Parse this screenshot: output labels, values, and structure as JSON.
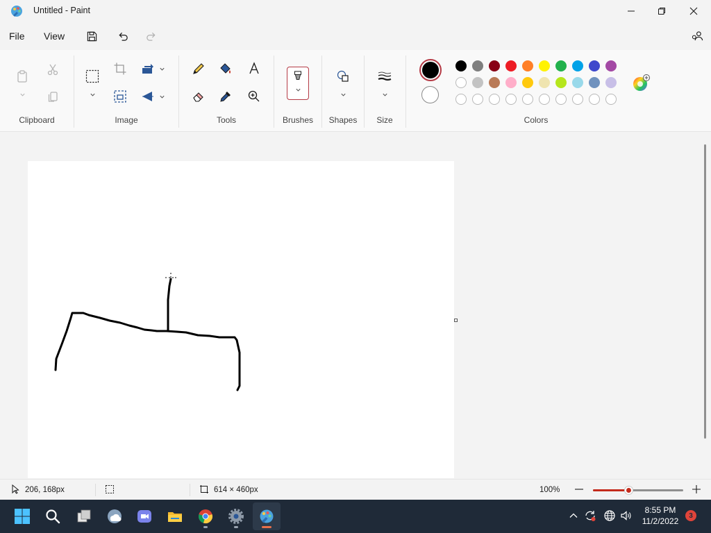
{
  "window": {
    "title": "Untitled - Paint",
    "controls": [
      "minimize-icon",
      "restore-icon",
      "close-icon"
    ]
  },
  "menu": {
    "file_label": "File",
    "view_label": "View",
    "quick_actions": [
      "save-icon",
      "undo-icon",
      "redo-icon"
    ]
  },
  "ribbon": {
    "clipboard": {
      "label": "Clipboard",
      "tools": [
        "paste-icon",
        "cut-icon",
        "copy-icon"
      ]
    },
    "image": {
      "label": "Image",
      "tools": [
        "select-icon",
        "crop-icon",
        "rotate-icon",
        "resize-icon",
        "flip-icon"
      ]
    },
    "tools": {
      "label": "Tools",
      "tools": [
        "pencil-icon",
        "fill-icon",
        "text-icon",
        "eraser-icon",
        "color-picker-icon",
        "magnifier-icon"
      ]
    },
    "brushes": {
      "label": "Brushes"
    },
    "shapes": {
      "label": "Shapes"
    },
    "size": {
      "label": "Size"
    },
    "colors": {
      "label": "Colors",
      "color1": "#000000",
      "color2": "#ffffff",
      "palette": [
        [
          "#000000",
          "#7f7f7f",
          "#880015",
          "#ed1c24",
          "#ff7f27",
          "#fff200",
          "#22b14c",
          "#00a2e8",
          "#3f48cc",
          "#a349a4"
        ],
        [
          "#ffffff",
          "#c3c3c3",
          "#b97a57",
          "#ffaec9",
          "#ffc90e",
          "#efe4b0",
          "#b5e61d",
          "#99d9ea",
          "#7092be",
          "#c8bfe7"
        ],
        [
          "",
          "",
          "",
          "",
          "",
          "",
          "",
          "",
          "",
          ""
        ]
      ]
    }
  },
  "status": {
    "cursor_position": "206, 168px",
    "canvas_size": "614 × 460px",
    "zoom": "100%",
    "zoom_level": 0.4
  },
  "taskbar": {
    "apps": [
      "start-icon",
      "search-icon",
      "task-view-icon",
      "weather-icon",
      "teams-icon",
      "file-explorer-icon",
      "chrome-icon",
      "settings-icon",
      "paint-icon"
    ],
    "time": "8:55 PM",
    "date": "11/2/2022",
    "notifications": "3"
  }
}
